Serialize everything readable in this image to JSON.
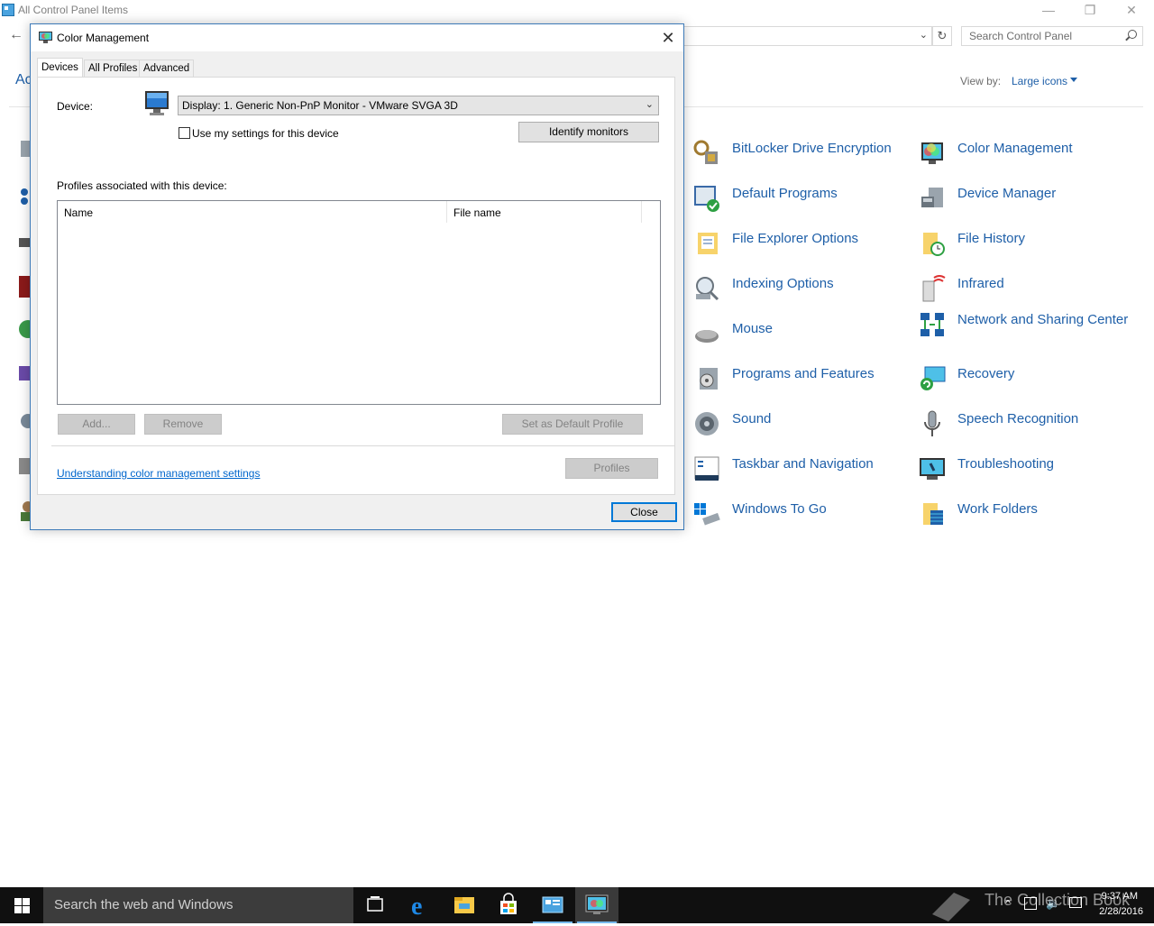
{
  "control_panel": {
    "window_title": "All Control Panel Items",
    "search_placeholder": "Search Control Panel",
    "adjust_partial": "Ac",
    "view_by_label": "View by:",
    "view_by_value": "Large icons",
    "items": [
      {
        "label": "BitLocker Drive Encryption",
        "icon": "bitlocker-icon"
      },
      {
        "label": "Color Management",
        "icon": "color-management-icon"
      },
      {
        "label": "Default Programs",
        "icon": "default-programs-icon"
      },
      {
        "label": "Device Manager",
        "icon": "device-manager-icon"
      },
      {
        "label": "File Explorer Options",
        "icon": "file-explorer-options-icon"
      },
      {
        "label": "File History",
        "icon": "file-history-icon"
      },
      {
        "label": "Indexing Options",
        "icon": "indexing-options-icon"
      },
      {
        "label": "Infrared",
        "icon": "infrared-icon"
      },
      {
        "label": "Mouse",
        "icon": "mouse-icon"
      },
      {
        "label": "Network and Sharing Center",
        "icon": "network-sharing-icon"
      },
      {
        "label": "Programs and Features",
        "icon": "programs-features-icon"
      },
      {
        "label": "Recovery",
        "icon": "recovery-icon"
      },
      {
        "label": "Sound",
        "icon": "sound-icon"
      },
      {
        "label": "Speech Recognition",
        "icon": "speech-recognition-icon"
      },
      {
        "label": "Taskbar and Navigation",
        "icon": "taskbar-navigation-icon"
      },
      {
        "label": "Troubleshooting",
        "icon": "troubleshooting-icon"
      },
      {
        "label": "Windows To Go",
        "icon": "windows-to-go-icon"
      },
      {
        "label": "Work Folders",
        "icon": "work-folders-icon"
      }
    ]
  },
  "dialog": {
    "title": "Color Management",
    "tabs": [
      "Devices",
      "All Profiles",
      "Advanced"
    ],
    "active_tab": "Devices",
    "device_label": "Device:",
    "device_value": "Display: 1. Generic Non-PnP Monitor - VMware SVGA 3D",
    "use_settings_label": "Use my settings for this device",
    "use_settings_checked": false,
    "identify_button": "Identify monitors",
    "profiles_label": "Profiles associated with this device:",
    "columns": [
      "Name",
      "File name"
    ],
    "add_button": "Add...",
    "remove_button": "Remove",
    "set_default_button": "Set as Default Profile",
    "link_text": "Understanding color management settings",
    "profiles_button": "Profiles",
    "close_button": "Close"
  },
  "taskbar": {
    "search_placeholder": "Search the web and Windows",
    "time": "9:37 AM",
    "date": "2/28/2016",
    "watermark": "The Collection Book"
  },
  "colors": {
    "link_blue": "#1e5fa8",
    "accent": "#0078d7",
    "taskbar": "#101010"
  }
}
